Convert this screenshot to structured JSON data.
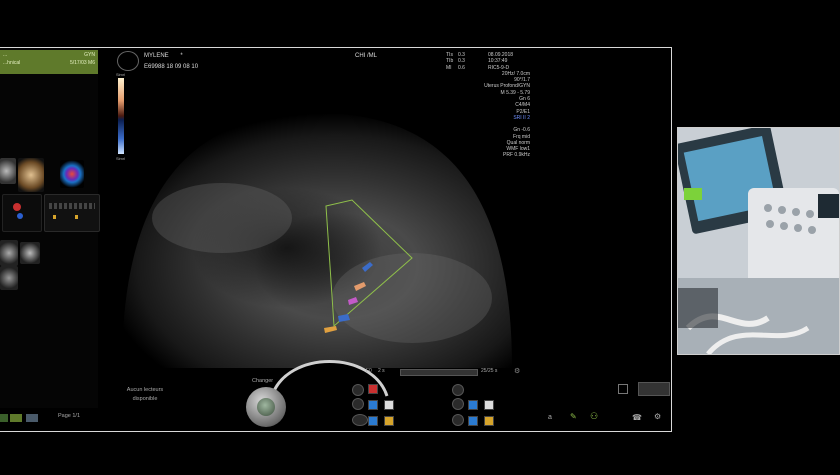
{
  "header": {
    "patient_name": "MYLENE",
    "patient_mark": "*",
    "patient_id": "E69988 18 09 08 10",
    "department": "CHI /ML",
    "tis": "TIs",
    "tis_val": "0.3",
    "tib": "TIb",
    "tib_val": "0.3",
    "mi": "MI",
    "mi_val": "0.6",
    "date": "08.09.2018",
    "time": "10:37:49",
    "probe": "RIC5-9-D",
    "freq_depth": "20Hz/ 7.0cm"
  },
  "left_panel": {
    "row1_left": "...",
    "row1_right": "GYN",
    "row2_left": "...hnical",
    "row2_right": "5/17/03 M6"
  },
  "params": [
    "90°/1.7",
    "Uterus Profond/GYN",
    "M 5.39 - 5.79",
    "Gn 6",
    "C4/M4",
    "P2/E1",
    "SRI II 2",
    "",
    "Gn -0.6",
    "Frq mid",
    "Qual norm",
    "WMF low1",
    "PRF 0.9kHz"
  ],
  "scale_top": "Simrl",
  "scale_bottom": "Simrl",
  "scale_marker": "1.0",
  "footer": {
    "no_reading": "Aucun lecteurs disponible",
    "change": "Changer",
    "page": "Page 1/1",
    "cine_left": "F0",
    "cine_left_val": "2 s",
    "cine_right": "25/25 s"
  },
  "colors": {
    "accent_green": "#5f7a2b",
    "scale_top": "#e39b6c",
    "scale_bottom": "#3b6cc9",
    "roi": "#8fbf4a"
  },
  "icons": [
    "gear-icon",
    "probe-icon",
    "folder-icon",
    "pencil-icon",
    "person-icon",
    "phone-icon",
    "settings-icon"
  ]
}
